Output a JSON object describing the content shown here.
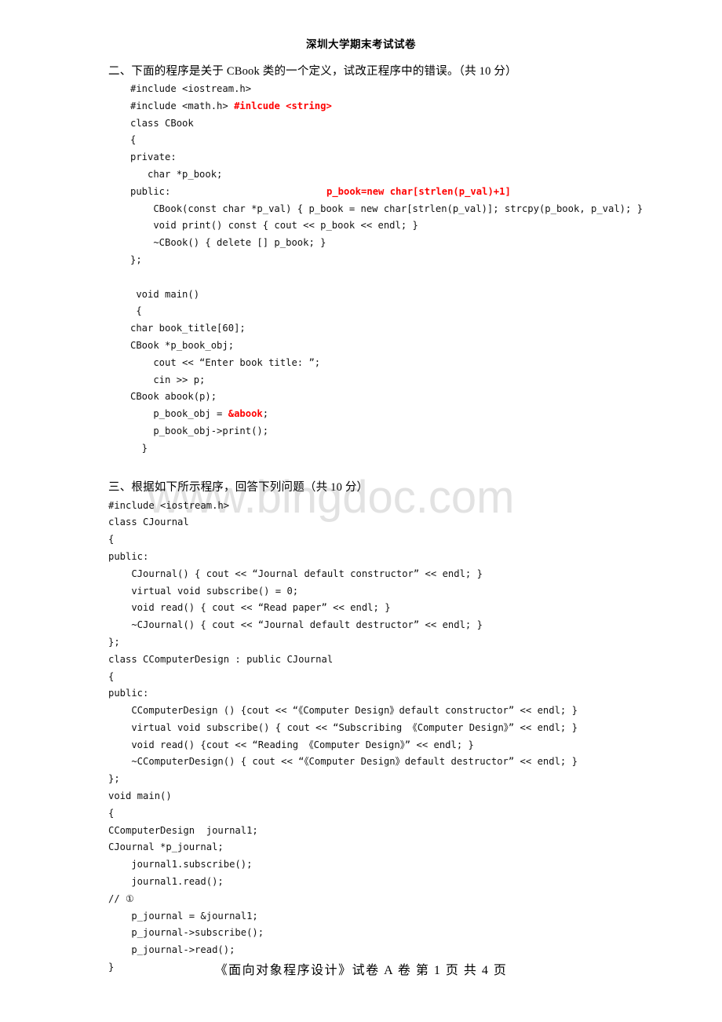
{
  "header": {
    "title": "深圳大学期末考试试卷"
  },
  "watermark": {
    "text": "www.bingdoc.com"
  },
  "question2": {
    "heading": "二、下面的程序是关于 CBook 类的一个定义，试改正程序中的错误。（共 10 分）",
    "annotation_public_line": "p_book=new char[strlen(p_val)+1]",
    "lines": [
      {
        "text": "#include <iostream.h>"
      },
      {
        "text": "#include <math.h> ",
        "red_suffix": "#inlcude <string>"
      },
      {
        "text": "class CBook"
      },
      {
        "text": "{"
      },
      {
        "text": "private:"
      },
      {
        "text": "   char *p_book;"
      },
      {
        "text": "public:",
        "annotation": true
      },
      {
        "text": "    CBook(const char *p_val) { p_book = new char[strlen(p_val)]; strcpy(p_book, p_val); }"
      },
      {
        "text": "    void print() const { cout << p_book << endl; }"
      },
      {
        "text": "    ~CBook() { delete [] p_book; }"
      },
      {
        "text": "};"
      },
      {
        "text": ""
      },
      {
        "text": " void main()"
      },
      {
        "text": " {"
      },
      {
        "text": "char book_title[60];"
      },
      {
        "text": "CBook *p_book_obj;"
      },
      {
        "text": "    cout << “Enter book title: ”;"
      },
      {
        "text": "    cin >> p;"
      },
      {
        "text": "CBook abook(p);"
      },
      {
        "text": "    p_book_obj = ",
        "red_suffix": "&abook",
        "tail": ";"
      },
      {
        "text": "    p_book_obj->print();"
      },
      {
        "text": "  }"
      }
    ]
  },
  "question3": {
    "heading": "三、根据如下所示程序，回答下列问题（共 10 分）",
    "lines": [
      {
        "text": "#include <iostream.h>"
      },
      {
        "text": "class CJournal"
      },
      {
        "text": "{"
      },
      {
        "text": "public:"
      },
      {
        "text": "    CJournal() { cout << “Journal default constructor” << endl; }"
      },
      {
        "text": "    virtual void subscribe() = 0;"
      },
      {
        "text": "    void read() { cout << “Read paper” << endl; }"
      },
      {
        "text": "    ~CJournal() { cout << “Journal default destructor” << endl; }"
      },
      {
        "text": "};"
      },
      {
        "text": "class CComputerDesign : public CJournal"
      },
      {
        "text": "{"
      },
      {
        "text": "public:"
      },
      {
        "text": "    CComputerDesign () {cout << “《Computer Design》default constructor” << endl; }"
      },
      {
        "text": "    virtual void subscribe() { cout << “Subscribing 《Computer Design》” << endl; }"
      },
      {
        "text": "    void read() {cout << “Reading 《Computer Design》” << endl; }"
      },
      {
        "text": "    ~CComputerDesign() { cout << “《Computer Design》default destructor” << endl; }"
      },
      {
        "text": "};"
      },
      {
        "text": "void main()"
      },
      {
        "text": "{"
      },
      {
        "text": "CComputerDesign  journal1;"
      },
      {
        "text": "CJournal *p_journal;"
      },
      {
        "text": "    journal1.subscribe();"
      },
      {
        "text": "    journal1.read();"
      },
      {
        "text": "// ①"
      },
      {
        "text": "    p_journal = &journal1;"
      },
      {
        "text": "    p_journal->subscribe();"
      },
      {
        "text": "    p_journal->read();"
      },
      {
        "text": "}"
      }
    ]
  },
  "footer": {
    "text": "《面向对象程序设计》试卷 A 卷  第 1 页 共 4 页"
  }
}
